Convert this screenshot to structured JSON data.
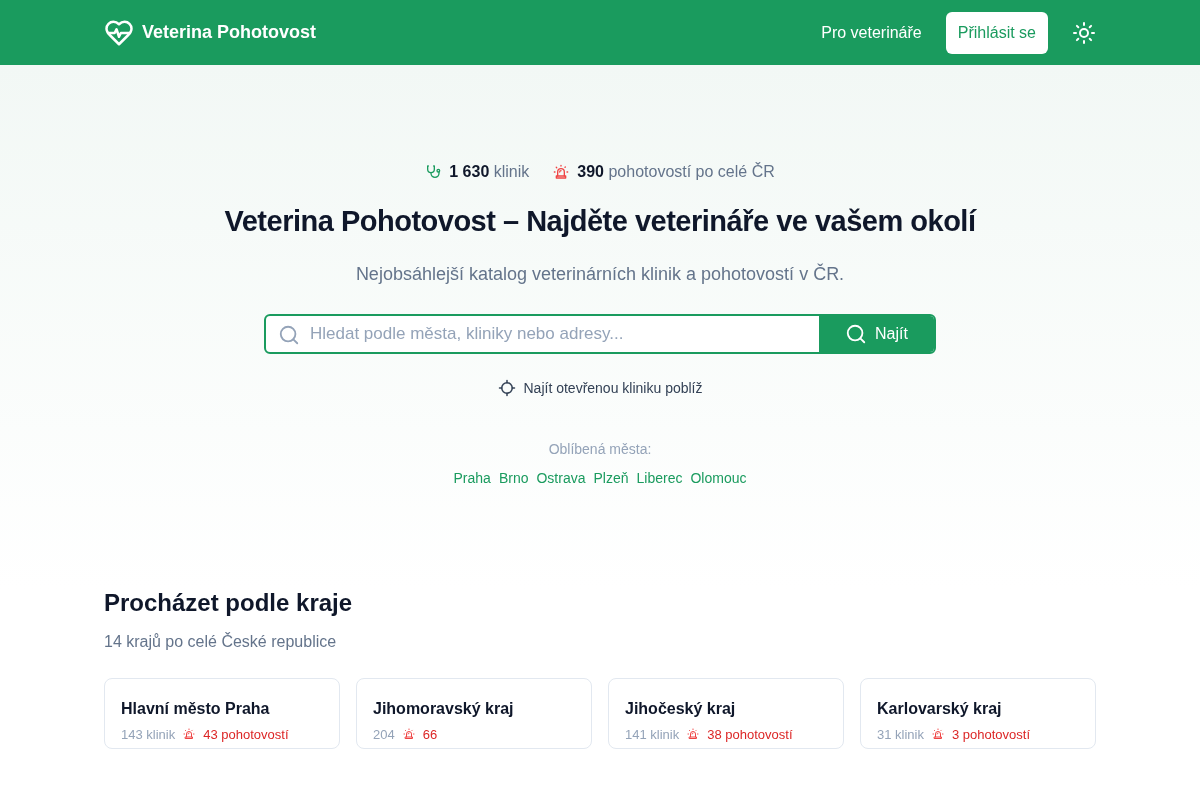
{
  "navbar": {
    "brand": "Veterina Pohotovost",
    "links": [
      "Pro veterináře"
    ],
    "login_button": "Přihlásit se"
  },
  "hero": {
    "stats": [
      {
        "kind": "clinics",
        "value": "1 630",
        "label": "klinik"
      },
      {
        "kind": "emergency",
        "value": "390",
        "label": "pohotovostí po celé ČR"
      }
    ],
    "title": "Veterina Pohotovost – Najděte veterináře ve vašem okolí",
    "subtitle": "Nejobsáhlejší katalog veterinárních klinik a pohotovostí v ČR.",
    "search": {
      "placeholder": "Hledat podle města, kliniky nebo adresy...",
      "button": "Najít"
    },
    "nearby_link": "Najít otevřenou kliniku poblíž",
    "popular_label": "Oblíbená města:",
    "cities": [
      "Praha",
      "Brno",
      "Ostrava",
      "Plzeň",
      "Liberec",
      "Olomouc"
    ]
  },
  "regions": {
    "title": "Procházet podle kraje",
    "subtitle": "14 krajů po celé České republice",
    "cards": [
      {
        "name": "Hlavní město Praha",
        "clinics": "143 klinik",
        "emergencies": "43 pohotovostí"
      },
      {
        "name": "Jihomoravský kraj",
        "clinics": "204",
        "emergencies": "66"
      },
      {
        "name": "Jihočeský kraj",
        "clinics": "141 klinik",
        "emergencies": "38 pohotovostí"
      },
      {
        "name": "Karlovarský kraj",
        "clinics": "31 klinik",
        "emergencies": "3 pohotovostí"
      }
    ]
  }
}
